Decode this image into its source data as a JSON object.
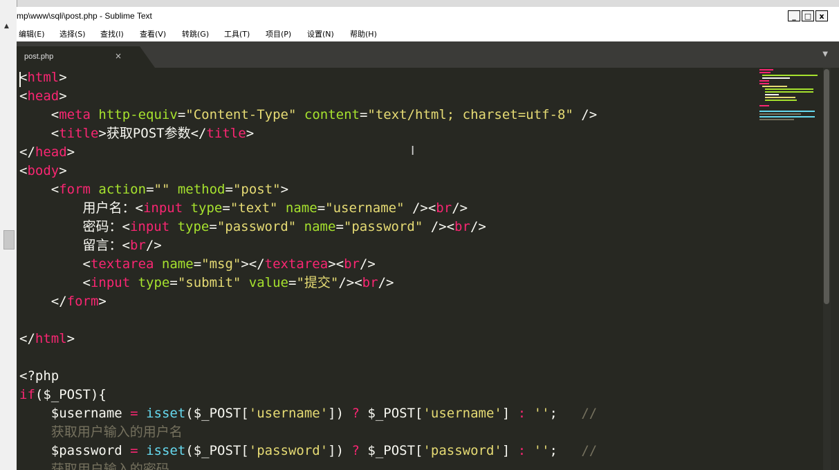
{
  "window": {
    "title": "mp\\www\\sqli\\post.php - Sublime Text",
    "controls": [
      "_",
      "□",
      "x"
    ]
  },
  "menu": [
    "编辑(E)",
    "选择(S)",
    "查找(I)",
    "查看(V)",
    "转跳(G)",
    "工具(T)",
    "项目(P)",
    "设置(N)",
    "帮助(H)"
  ],
  "tab": {
    "label": "post.php",
    "close": "×"
  },
  "editor": {
    "colors": {
      "background": "#272822",
      "tag": "#f92672",
      "attr": "#a6e22e",
      "string": "#e6db74",
      "func": "#66d9ef",
      "comment": "#75715e",
      "text": "#f8f8f2"
    },
    "lines": [
      [
        [
          "p",
          "<"
        ],
        [
          "t",
          "html"
        ],
        [
          "p",
          ">"
        ]
      ],
      [
        [
          "p",
          "<"
        ],
        [
          "t",
          "head"
        ],
        [
          "p",
          ">"
        ]
      ],
      [
        [
          "p",
          "    <"
        ],
        [
          "t",
          "meta"
        ],
        [
          "p",
          " "
        ],
        [
          "a",
          "http-equiv"
        ],
        [
          "p",
          "="
        ],
        [
          "s",
          "\"Content-Type\""
        ],
        [
          "p",
          " "
        ],
        [
          "a",
          "content"
        ],
        [
          "p",
          "="
        ],
        [
          "s",
          "\"text/html; charset=utf-8\""
        ],
        [
          "p",
          " />"
        ]
      ],
      [
        [
          "p",
          "    <"
        ],
        [
          "t",
          "title"
        ],
        [
          "p",
          ">获取POST参数</"
        ],
        [
          "t",
          "title"
        ],
        [
          "p",
          ">"
        ]
      ],
      [
        [
          "p",
          "</"
        ],
        [
          "t",
          "head"
        ],
        [
          "p",
          ">"
        ]
      ],
      [
        [
          "p",
          "<"
        ],
        [
          "t",
          "body"
        ],
        [
          "p",
          ">"
        ]
      ],
      [
        [
          "p",
          "    <"
        ],
        [
          "t",
          "form"
        ],
        [
          "p",
          " "
        ],
        [
          "a",
          "action"
        ],
        [
          "p",
          "="
        ],
        [
          "s",
          "\"\""
        ],
        [
          "p",
          " "
        ],
        [
          "a",
          "method"
        ],
        [
          "p",
          "="
        ],
        [
          "s",
          "\"post\""
        ],
        [
          "p",
          ">"
        ]
      ],
      [
        [
          "p",
          "        用户名：<"
        ],
        [
          "t",
          "input"
        ],
        [
          "p",
          " "
        ],
        [
          "a",
          "type"
        ],
        [
          "p",
          "="
        ],
        [
          "s",
          "\"text\""
        ],
        [
          "p",
          " "
        ],
        [
          "a",
          "name"
        ],
        [
          "p",
          "="
        ],
        [
          "s",
          "\"username\""
        ],
        [
          "p",
          " /><"
        ],
        [
          "t",
          "br"
        ],
        [
          "p",
          "/>"
        ]
      ],
      [
        [
          "p",
          "        密码：<"
        ],
        [
          "t",
          "input"
        ],
        [
          "p",
          " "
        ],
        [
          "a",
          "type"
        ],
        [
          "p",
          "="
        ],
        [
          "s",
          "\"password\""
        ],
        [
          "p",
          " "
        ],
        [
          "a",
          "name"
        ],
        [
          "p",
          "="
        ],
        [
          "s",
          "\"password\""
        ],
        [
          "p",
          " /><"
        ],
        [
          "t",
          "br"
        ],
        [
          "p",
          "/>"
        ]
      ],
      [
        [
          "p",
          "        留言：<"
        ],
        [
          "t",
          "br"
        ],
        [
          "p",
          "/>"
        ]
      ],
      [
        [
          "p",
          "        <"
        ],
        [
          "t",
          "textarea"
        ],
        [
          "p",
          " "
        ],
        [
          "a",
          "name"
        ],
        [
          "p",
          "="
        ],
        [
          "s",
          "\"msg\""
        ],
        [
          "p",
          "></"
        ],
        [
          "t",
          "textarea"
        ],
        [
          "p",
          "><"
        ],
        [
          "t",
          "br"
        ],
        [
          "p",
          "/>"
        ]
      ],
      [
        [
          "p",
          "        <"
        ],
        [
          "t",
          "input"
        ],
        [
          "p",
          " "
        ],
        [
          "a",
          "type"
        ],
        [
          "p",
          "="
        ],
        [
          "s",
          "\"submit\""
        ],
        [
          "p",
          " "
        ],
        [
          "a",
          "value"
        ],
        [
          "p",
          "="
        ],
        [
          "s",
          "\"提交\""
        ],
        [
          "p",
          "/><"
        ],
        [
          "t",
          "br"
        ],
        [
          "p",
          "/>"
        ]
      ],
      [
        [
          "p",
          "    </"
        ],
        [
          "t",
          "form"
        ],
        [
          "p",
          ">"
        ]
      ],
      [],
      [
        [
          "p",
          "</"
        ],
        [
          "t",
          "html"
        ],
        [
          "p",
          ">"
        ]
      ],
      [],
      [
        [
          "p",
          "<?php"
        ]
      ],
      [
        [
          "t",
          "if"
        ],
        [
          "p",
          "($_POST){"
        ]
      ],
      [
        [
          "p",
          "    $username "
        ],
        [
          "t",
          "="
        ],
        [
          "p",
          " "
        ],
        [
          "f",
          "isset"
        ],
        [
          "p",
          "($_POST["
        ],
        [
          "s",
          "'username'"
        ],
        [
          "p",
          "]) "
        ],
        [
          "t",
          "?"
        ],
        [
          "p",
          " $_POST["
        ],
        [
          "s",
          "'username'"
        ],
        [
          "p",
          "] "
        ],
        [
          "t",
          ":"
        ],
        [
          "p",
          " "
        ],
        [
          "s",
          "''"
        ],
        [
          "p",
          ";   "
        ],
        [
          "c",
          "//"
        ]
      ],
      [
        [
          "c",
          "    获取用户输入的用户名"
        ]
      ],
      [
        [
          "p",
          "    $password "
        ],
        [
          "t",
          "="
        ],
        [
          "p",
          " "
        ],
        [
          "f",
          "isset"
        ],
        [
          "p",
          "($_POST["
        ],
        [
          "s",
          "'password'"
        ],
        [
          "p",
          "]) "
        ],
        [
          "t",
          "?"
        ],
        [
          "p",
          " $_POST["
        ],
        [
          "s",
          "'password'"
        ],
        [
          "p",
          "] "
        ],
        [
          "t",
          ":"
        ],
        [
          "p",
          " "
        ],
        [
          "s",
          "''"
        ],
        [
          "p",
          ";   "
        ],
        [
          "c",
          "//"
        ]
      ],
      [
        [
          "c",
          "    获取用户输入的密码"
        ]
      ]
    ]
  }
}
